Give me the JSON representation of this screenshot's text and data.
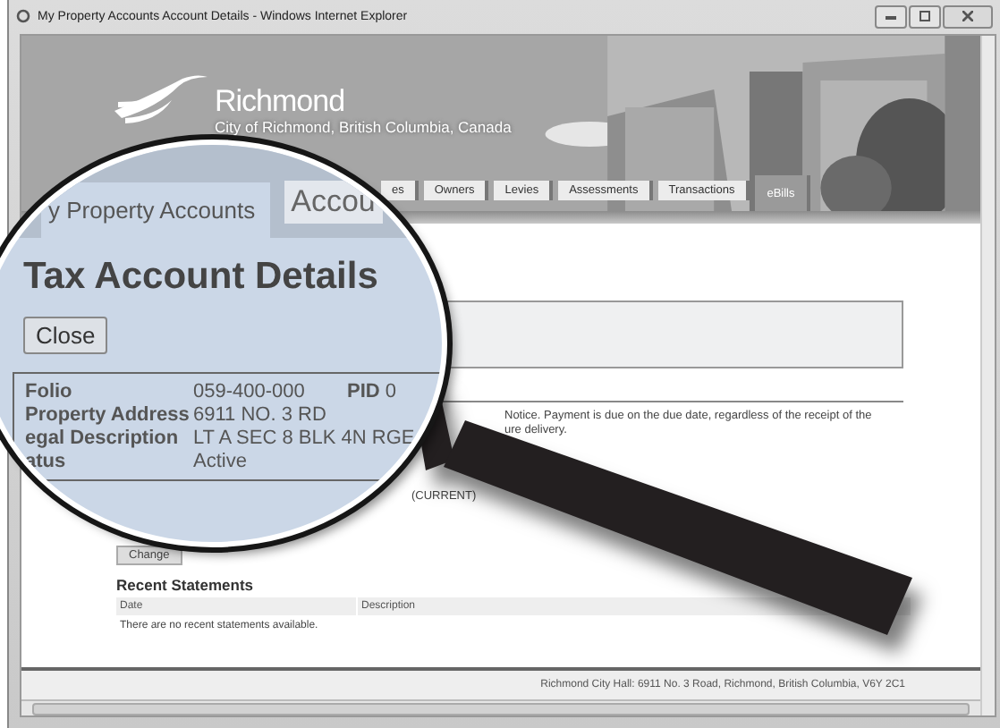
{
  "window": {
    "title": "My Property Accounts Account Details - Windows Internet Explorer"
  },
  "header": {
    "title": "Richmond",
    "subtitle": "City of Richmond, British Columbia, Canada"
  },
  "nav_tabs": [
    {
      "label": "es",
      "selected": false
    },
    {
      "label": "Owners",
      "selected": false
    },
    {
      "label": "Levies",
      "selected": false
    },
    {
      "label": "Assessments",
      "selected": false
    },
    {
      "label": "Transactions",
      "selected": false
    },
    {
      "label": "eBills",
      "selected": true
    }
  ],
  "magnifier": {
    "tabs": [
      {
        "label": "y Property Accounts",
        "selected": true
      },
      {
        "label": "Accou",
        "selected": false
      }
    ],
    "heading": "Tax Account Details",
    "close_button": "Close",
    "details": [
      {
        "label": "Folio",
        "value": "059-400-000",
        "extra_label": "PID",
        "extra_value": "0"
      },
      {
        "label": "Property Address",
        "value": "6911 NO. 3 RD"
      },
      {
        "label": "egal Description",
        "value": "LT A SEC 8 BLK 4N RGE"
      },
      {
        "label": "atus",
        "value": "Active"
      }
    ]
  },
  "notice": [
    "Notice. Payment is due on the due date, regardless of the receipt of the",
    "ure delivery."
  ],
  "status_fragment": "(CURRENT)",
  "change_button": "Change",
  "recent_statements": {
    "title": "Recent Statements",
    "columns": [
      "Date",
      "Description"
    ],
    "empty_message": "There are no recent statements available."
  },
  "footer": "Richmond City Hall: 6911 No. 3 Road, Richmond, British Columbia, V6Y 2C1"
}
